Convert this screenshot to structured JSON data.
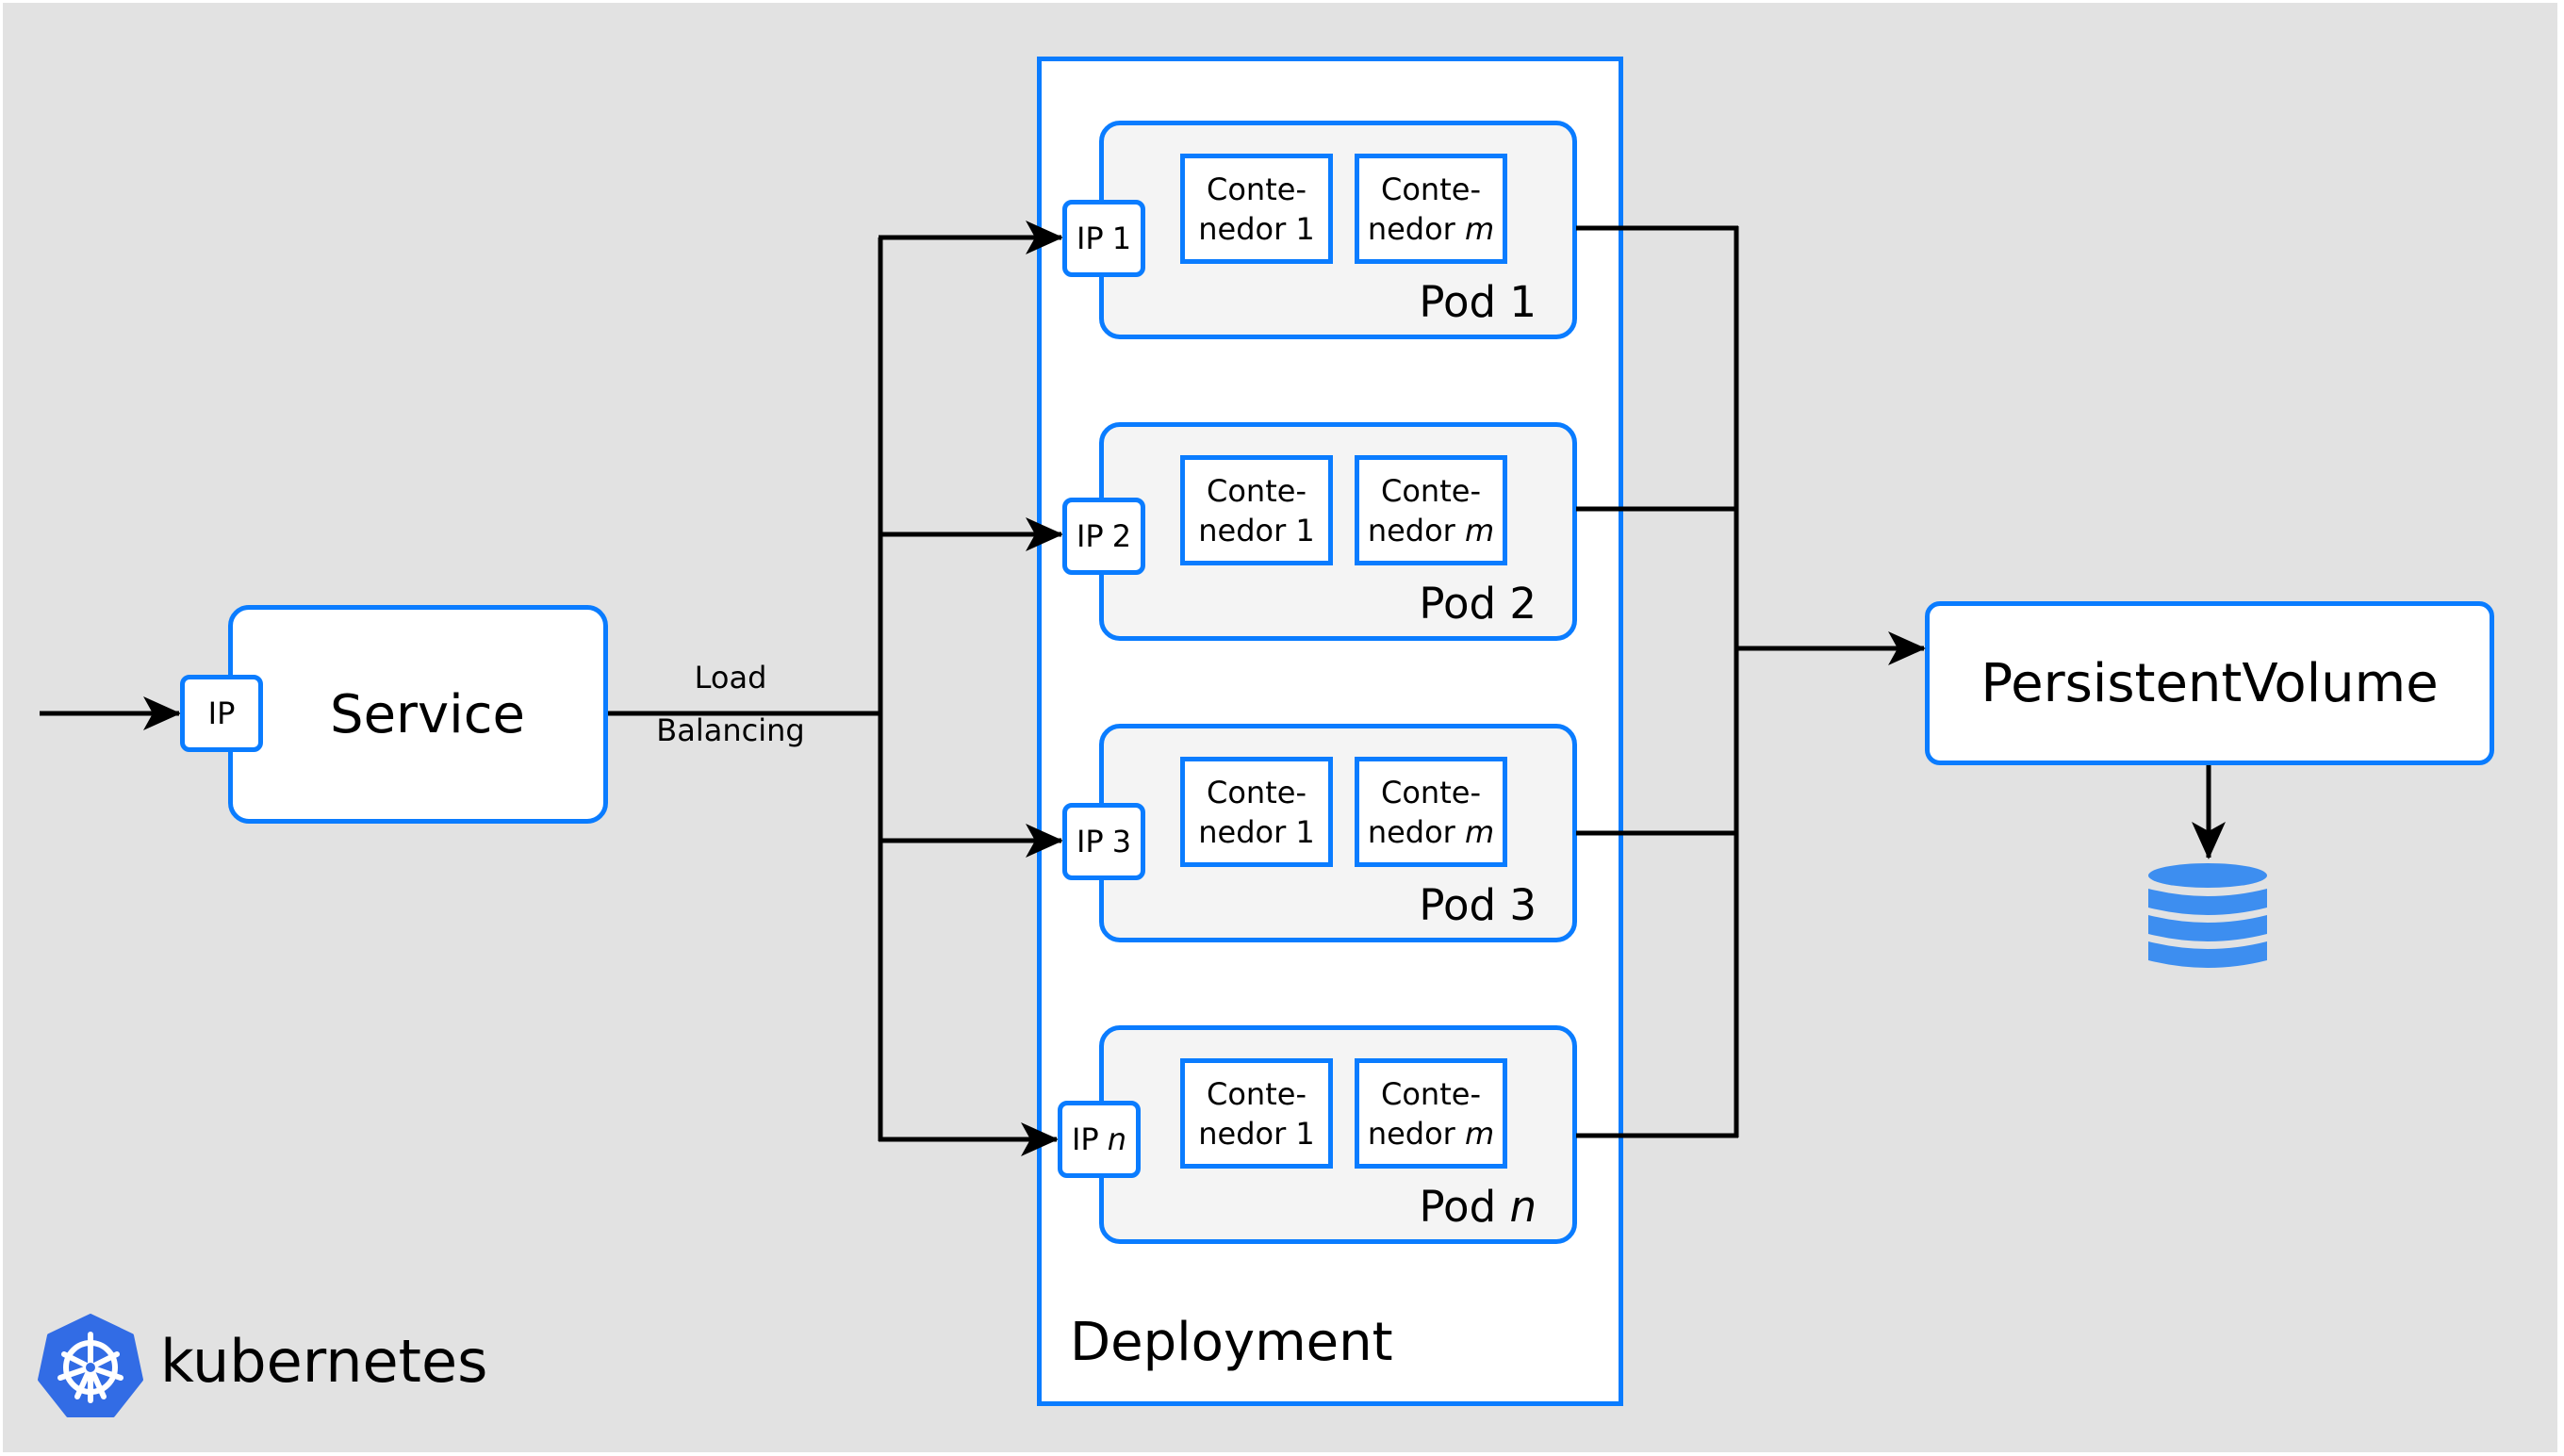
{
  "diagram": {
    "service": {
      "label": "Service",
      "ip_label": "IP"
    },
    "load_balancing": {
      "line1": "Load",
      "line2": "Balancing"
    },
    "deployment": {
      "label": "Deployment"
    },
    "pods": [
      {
        "label": "Pod",
        "index": "1",
        "index_italic": false,
        "ip_prefix": "IP",
        "ip_index": "1",
        "ip_italic": false,
        "containers": [
          {
            "line1": "Conte-",
            "line2_prefix": "nedor",
            "line2_index": "1",
            "italic": false
          },
          {
            "line1": "Conte-",
            "line2_prefix": "nedor",
            "line2_index": "m",
            "italic": true
          }
        ]
      },
      {
        "label": "Pod",
        "index": "2",
        "index_italic": false,
        "ip_prefix": "IP",
        "ip_index": "2",
        "ip_italic": false,
        "containers": [
          {
            "line1": "Conte-",
            "line2_prefix": "nedor",
            "line2_index": "1",
            "italic": false
          },
          {
            "line1": "Conte-",
            "line2_prefix": "nedor",
            "line2_index": "m",
            "italic": true
          }
        ]
      },
      {
        "label": "Pod",
        "index": "3",
        "index_italic": false,
        "ip_prefix": "IP",
        "ip_index": "3",
        "ip_italic": false,
        "containers": [
          {
            "line1": "Conte-",
            "line2_prefix": "nedor",
            "line2_index": "1",
            "italic": false
          },
          {
            "line1": "Conte-",
            "line2_prefix": "nedor",
            "line2_index": "m",
            "italic": true
          }
        ]
      },
      {
        "label": "Pod",
        "index": "n",
        "index_italic": true,
        "ip_prefix": "IP",
        "ip_index": "n",
        "ip_italic": true,
        "containers": [
          {
            "line1": "Conte-",
            "line2_prefix": "nedor",
            "line2_index": "1",
            "italic": false
          },
          {
            "line1": "Conte-",
            "line2_prefix": "nedor",
            "line2_index": "m",
            "italic": true
          }
        ]
      }
    ],
    "persistent_volume": {
      "label": "PersistentVolume"
    },
    "storage_icon": "database-icon",
    "brand": {
      "name": "kubernetes",
      "icon": "kubernetes-helm-icon"
    }
  },
  "colors": {
    "accent_border": "#0a7cff",
    "background": "#e2e2e2",
    "pod_fill": "#f4f4f4",
    "database": "#3d8ef0",
    "kubernetes_blue": "#326ce5"
  }
}
